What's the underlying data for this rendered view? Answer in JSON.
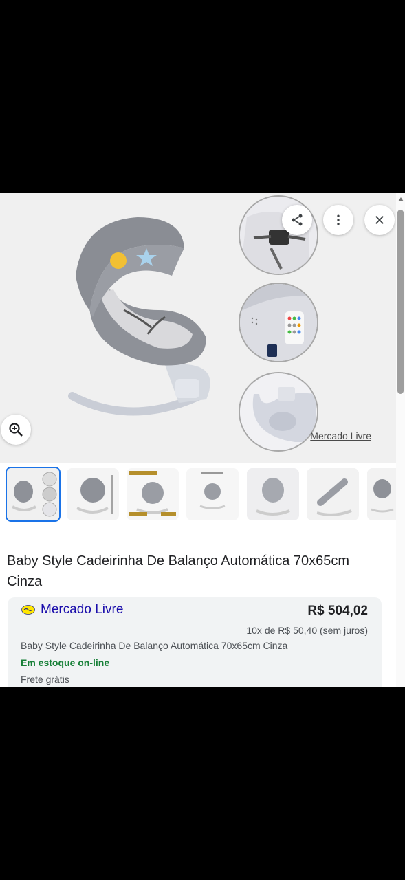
{
  "header": {
    "share_icon": "share-icon",
    "more_icon": "more-vert-icon",
    "close_icon": "close-icon",
    "zoom_icon": "zoom-in-icon"
  },
  "source": {
    "label": "Mercado Livre"
  },
  "thumbnails": [
    {
      "name": "thumbnail-1",
      "selected": true
    },
    {
      "name": "thumbnail-2",
      "selected": false
    },
    {
      "name": "thumbnail-3",
      "selected": false
    },
    {
      "name": "thumbnail-4",
      "selected": false
    },
    {
      "name": "thumbnail-5",
      "selected": false
    },
    {
      "name": "thumbnail-6",
      "selected": false
    },
    {
      "name": "thumbnail-7",
      "selected": false
    }
  ],
  "product": {
    "title": "Baby Style Cadeirinha De Balanço Automática 70x65cm Cinza"
  },
  "offer": {
    "merchant": "Mercado Livre",
    "price": "R$ 504,02",
    "installments": "10x de R$ 50,40 (sem juros)",
    "title": "Baby Style Cadeirinha De Balanço Automática 70x65cm Cinza",
    "stock": "Em estoque on-line",
    "shipping": "Frete grátis"
  },
  "colors": {
    "accent": "#1a73e8",
    "link": "#1a0dab",
    "stock_green": "#188038"
  }
}
